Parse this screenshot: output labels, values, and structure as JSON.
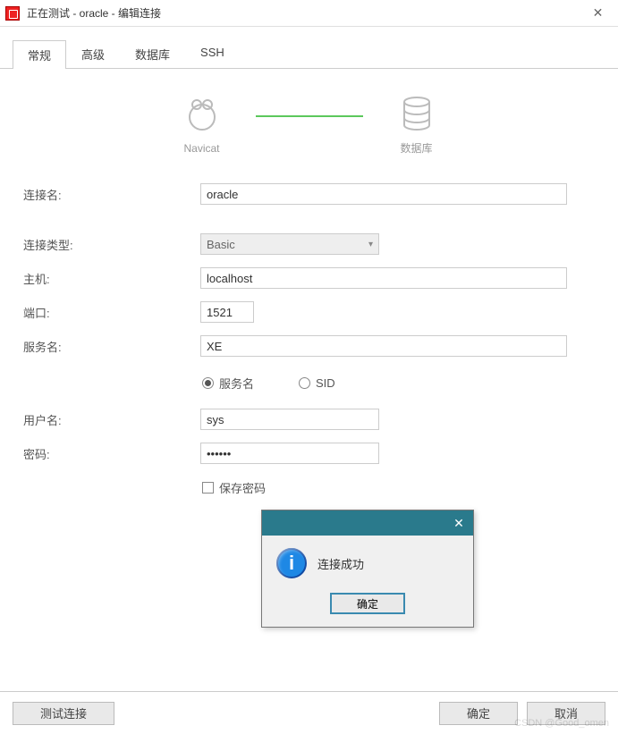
{
  "window": {
    "title": "正在测试 - oracle - 编辑连接"
  },
  "tabs": {
    "general": "常规",
    "advanced": "高级",
    "database": "数据库",
    "ssh": "SSH"
  },
  "diagram": {
    "left": "Navicat",
    "right": "数据库"
  },
  "labels": {
    "conn_name": "连接名:",
    "conn_type": "连接类型:",
    "host": "主机:",
    "port": "端口:",
    "service_name": "服务名:",
    "username": "用户名:",
    "password": "密码:",
    "save_password": "保存密码"
  },
  "values": {
    "conn_name": "oracle",
    "conn_type": "Basic",
    "host": "localhost",
    "port": "1521",
    "service_name": "XE",
    "username": "sys",
    "password": "••••••"
  },
  "radios": {
    "service_name": "服务名",
    "sid": "SID"
  },
  "modal": {
    "message": "连接成功",
    "ok": "确定"
  },
  "footer": {
    "test": "测试连接",
    "ok": "确定",
    "cancel": "取消"
  },
  "watermark": "CSDN @Good_omen"
}
